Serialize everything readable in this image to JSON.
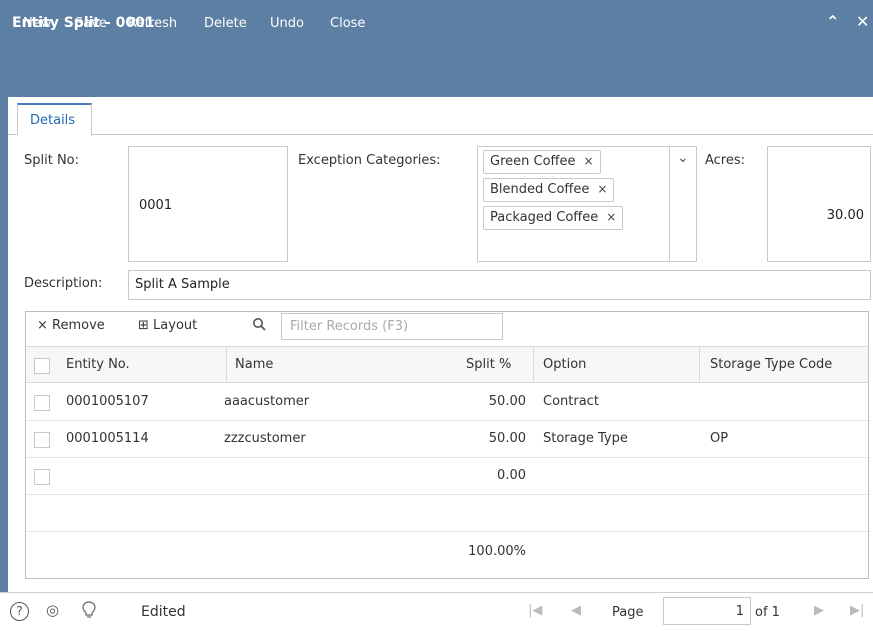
{
  "window": {
    "title": "Entity Split - 0001",
    "collapse_icon": "chevron-up-icon",
    "close_icon": "close-icon"
  },
  "toolbar": {
    "new": "New",
    "save": "Save",
    "refresh": "Refresh",
    "delete": "Delete",
    "undo": "Undo",
    "close": "Close"
  },
  "tabs": [
    {
      "label": "Details"
    }
  ],
  "form": {
    "split_no_label": "Split No:",
    "split_no_value": "0001",
    "exception_label": "Exception Categories:",
    "exception_chips": [
      "Green Coffee",
      "Blended Coffee",
      "Packaged Coffee"
    ],
    "chip_remove": "×",
    "dropdown_glyph": "⌄",
    "acres_label": "Acres:",
    "acres_value": "30.00",
    "description_label": "Description:",
    "description_value": "Split A Sample"
  },
  "grid": {
    "remove_label": "Remove",
    "remove_glyph": "×",
    "layout_label": "Layout",
    "layout_glyph": "⊞",
    "search_glyph": "🔍",
    "filter_placeholder": "Filter Records (F3)",
    "columns": [
      "Entity No.",
      "Name",
      "Split %",
      "Option",
      "Storage Type Code"
    ],
    "rows": [
      {
        "entity_no": "0001005107",
        "name": "aaacustomer",
        "split": "50.00",
        "option": "Contract",
        "storage": ""
      },
      {
        "entity_no": "0001005114",
        "name": "zzzcustomer",
        "split": "50.00",
        "option": "Storage Type",
        "storage": "OP"
      },
      {
        "entity_no": "",
        "name": "",
        "split": "0.00",
        "option": "",
        "storage": ""
      }
    ],
    "total": "100.00%"
  },
  "status": {
    "help_glyph": "?",
    "support_glyph": "◎",
    "idea_glyph": "♀",
    "state": "Edited",
    "first_glyph": "⏮",
    "prev_glyph": "◀",
    "page_label": "Page",
    "page_value": "1",
    "of_label": "of 1",
    "next_glyph": "▶",
    "last_glyph": "⏭"
  }
}
